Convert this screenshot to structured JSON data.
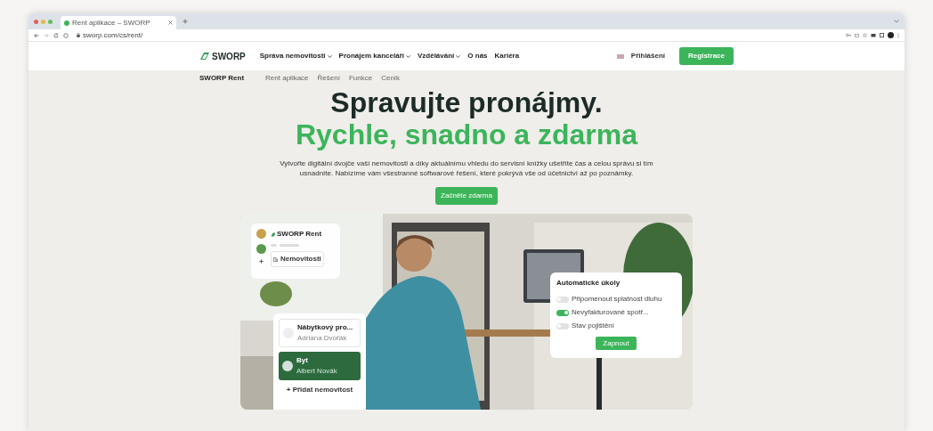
{
  "browser": {
    "tab_title": "Rent aplikace – SWORP",
    "url": "sworp.com/cs/rent/"
  },
  "nav": {
    "logo": "SWORP",
    "items": [
      {
        "label": "Správa nemovitostí",
        "dropdown": true
      },
      {
        "label": "Pronájem kanceláří",
        "dropdown": true
      },
      {
        "label": "Vzdělávání",
        "dropdown": true
      },
      {
        "label": "O nás",
        "dropdown": false
      },
      {
        "label": "Kariéra",
        "dropdown": false
      }
    ],
    "login": "Přihlášení",
    "register": "Registrace"
  },
  "subnav": {
    "title": "SWORP Rent",
    "items": [
      "Rent aplikace",
      "Řešení",
      "Funkce",
      "Ceník"
    ]
  },
  "hero": {
    "heading": "Spravujte pronájmy.",
    "subheading": "Rychle, snadno a zdarma",
    "text": "Vytvořte digitální dvojče vaší nemovitosti a díky aktuálnímu vhledu do servisní knížky ušetříte čas a celou správu si tím usnadníte. Nabízíme vám všestranné softwarové řešení, které pokrývá vše od účetnictví až po poznámky.",
    "cta": "Začněte zdarma"
  },
  "app_card": {
    "logo": "SWORP Rent",
    "menu_item": "Nemovitosti"
  },
  "property_card": {
    "items": [
      {
        "title": "Nábytkový pro...",
        "subtitle": "Adriana Dvořák",
        "selected": false
      },
      {
        "title": "Byt",
        "subtitle": "Albert Novák",
        "selected": true
      }
    ],
    "add": "+ Přidat nemovitost"
  },
  "automation_card": {
    "title": "Automatické úkoly",
    "toggles": [
      {
        "label": "Připomenout splatnost dluhu",
        "on": false
      },
      {
        "label": "Nevyfakturované spotř...",
        "on": true
      },
      {
        "label": "Stav pojištění",
        "on": false
      }
    ],
    "button": "Zapnout"
  }
}
